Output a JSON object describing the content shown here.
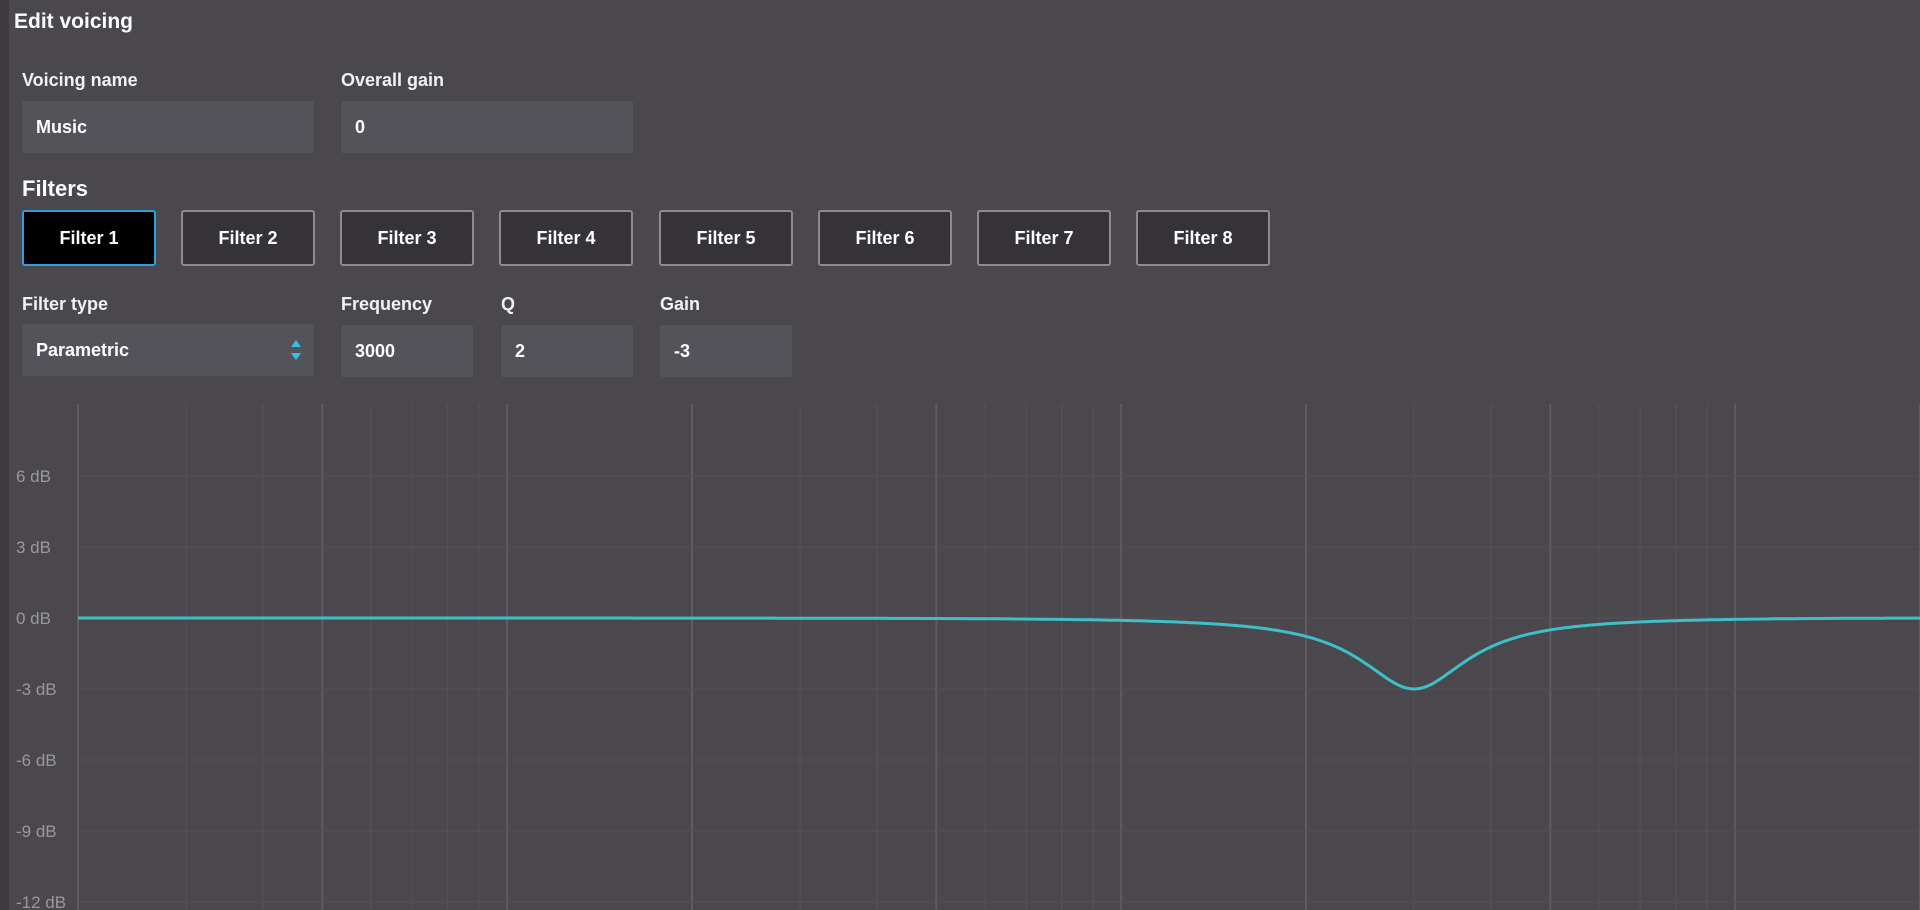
{
  "title": "Edit voicing",
  "voicing": {
    "name_label": "Voicing name",
    "name_value": "Music",
    "gain_label": "Overall gain",
    "gain_value": "0"
  },
  "filters": {
    "heading": "Filters",
    "tabs": [
      "Filter 1",
      "Filter 2",
      "Filter 3",
      "Filter 4",
      "Filter 5",
      "Filter 6",
      "Filter 7",
      "Filter 8"
    ],
    "selected_tab": "Filter 1"
  },
  "filter_settings": {
    "type_label": "Filter type",
    "type_value": "Parametric",
    "frequency_label": "Frequency",
    "frequency_value": "3000",
    "q_label": "Q",
    "q_value": "2",
    "gain_label": "Gain",
    "gain_value": "-3"
  },
  "icons": {
    "select": "updown-arrows-icon"
  },
  "colors": {
    "accent": "#2e9fd8",
    "curve": "#3fc0c8",
    "background": "#4a484d"
  },
  "chart_data": {
    "type": "line",
    "y_ticks": [
      "6 dB",
      "3 dB",
      "0 dB",
      "-3 dB",
      "-6 dB",
      "-9 dB",
      "-12 dB"
    ],
    "ylim": [
      -12,
      9
    ],
    "x_scale": "log",
    "xlim": [
      20,
      20000
    ],
    "grid": true,
    "series": [
      {
        "filter": "parametric",
        "center_hz": 3000,
        "q": 2,
        "gain_db": -3
      }
    ]
  }
}
